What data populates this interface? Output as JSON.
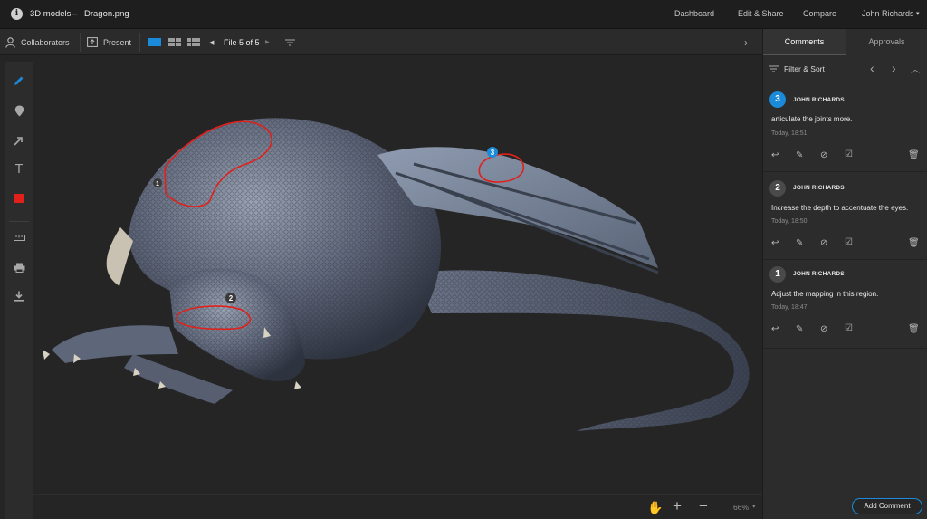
{
  "header": {
    "section": "3D models",
    "separator": "–",
    "filename": "Dragon.png",
    "nav": [
      "Dashboard",
      "Edit & Share",
      "Compare",
      "John Richards"
    ],
    "user_caret": "▾"
  },
  "toolbar": {
    "collaborators": "Collaborators",
    "present": "Present",
    "file_indicator": "File 5 of 5"
  },
  "canvas": {
    "markers": [
      "1",
      "2",
      "3"
    ]
  },
  "bottom": {
    "zoom": "66%",
    "zoom_caret": "▾"
  },
  "panel": {
    "tabs": [
      "Comments",
      "Approvals"
    ],
    "filter_label": "Filter & Sort",
    "comments": [
      {
        "number": "3",
        "author": "JOHN RICHARDS",
        "text": "articulate the joints more.",
        "time": "Today, 18:51"
      },
      {
        "number": "2",
        "author": "JOHN RICHARDS",
        "text": "Increase the depth to accentuate the eyes.",
        "time": "Today, 18:50"
      },
      {
        "number": "1",
        "author": "JOHN RICHARDS",
        "text": "Adjust the mapping in this region.",
        "time": "Today, 18:47"
      }
    ],
    "add_comment": "Add Comment"
  },
  "colors": {
    "accent": "#1b8ad8",
    "annotation": "#e0201b",
    "background": "#252525"
  }
}
